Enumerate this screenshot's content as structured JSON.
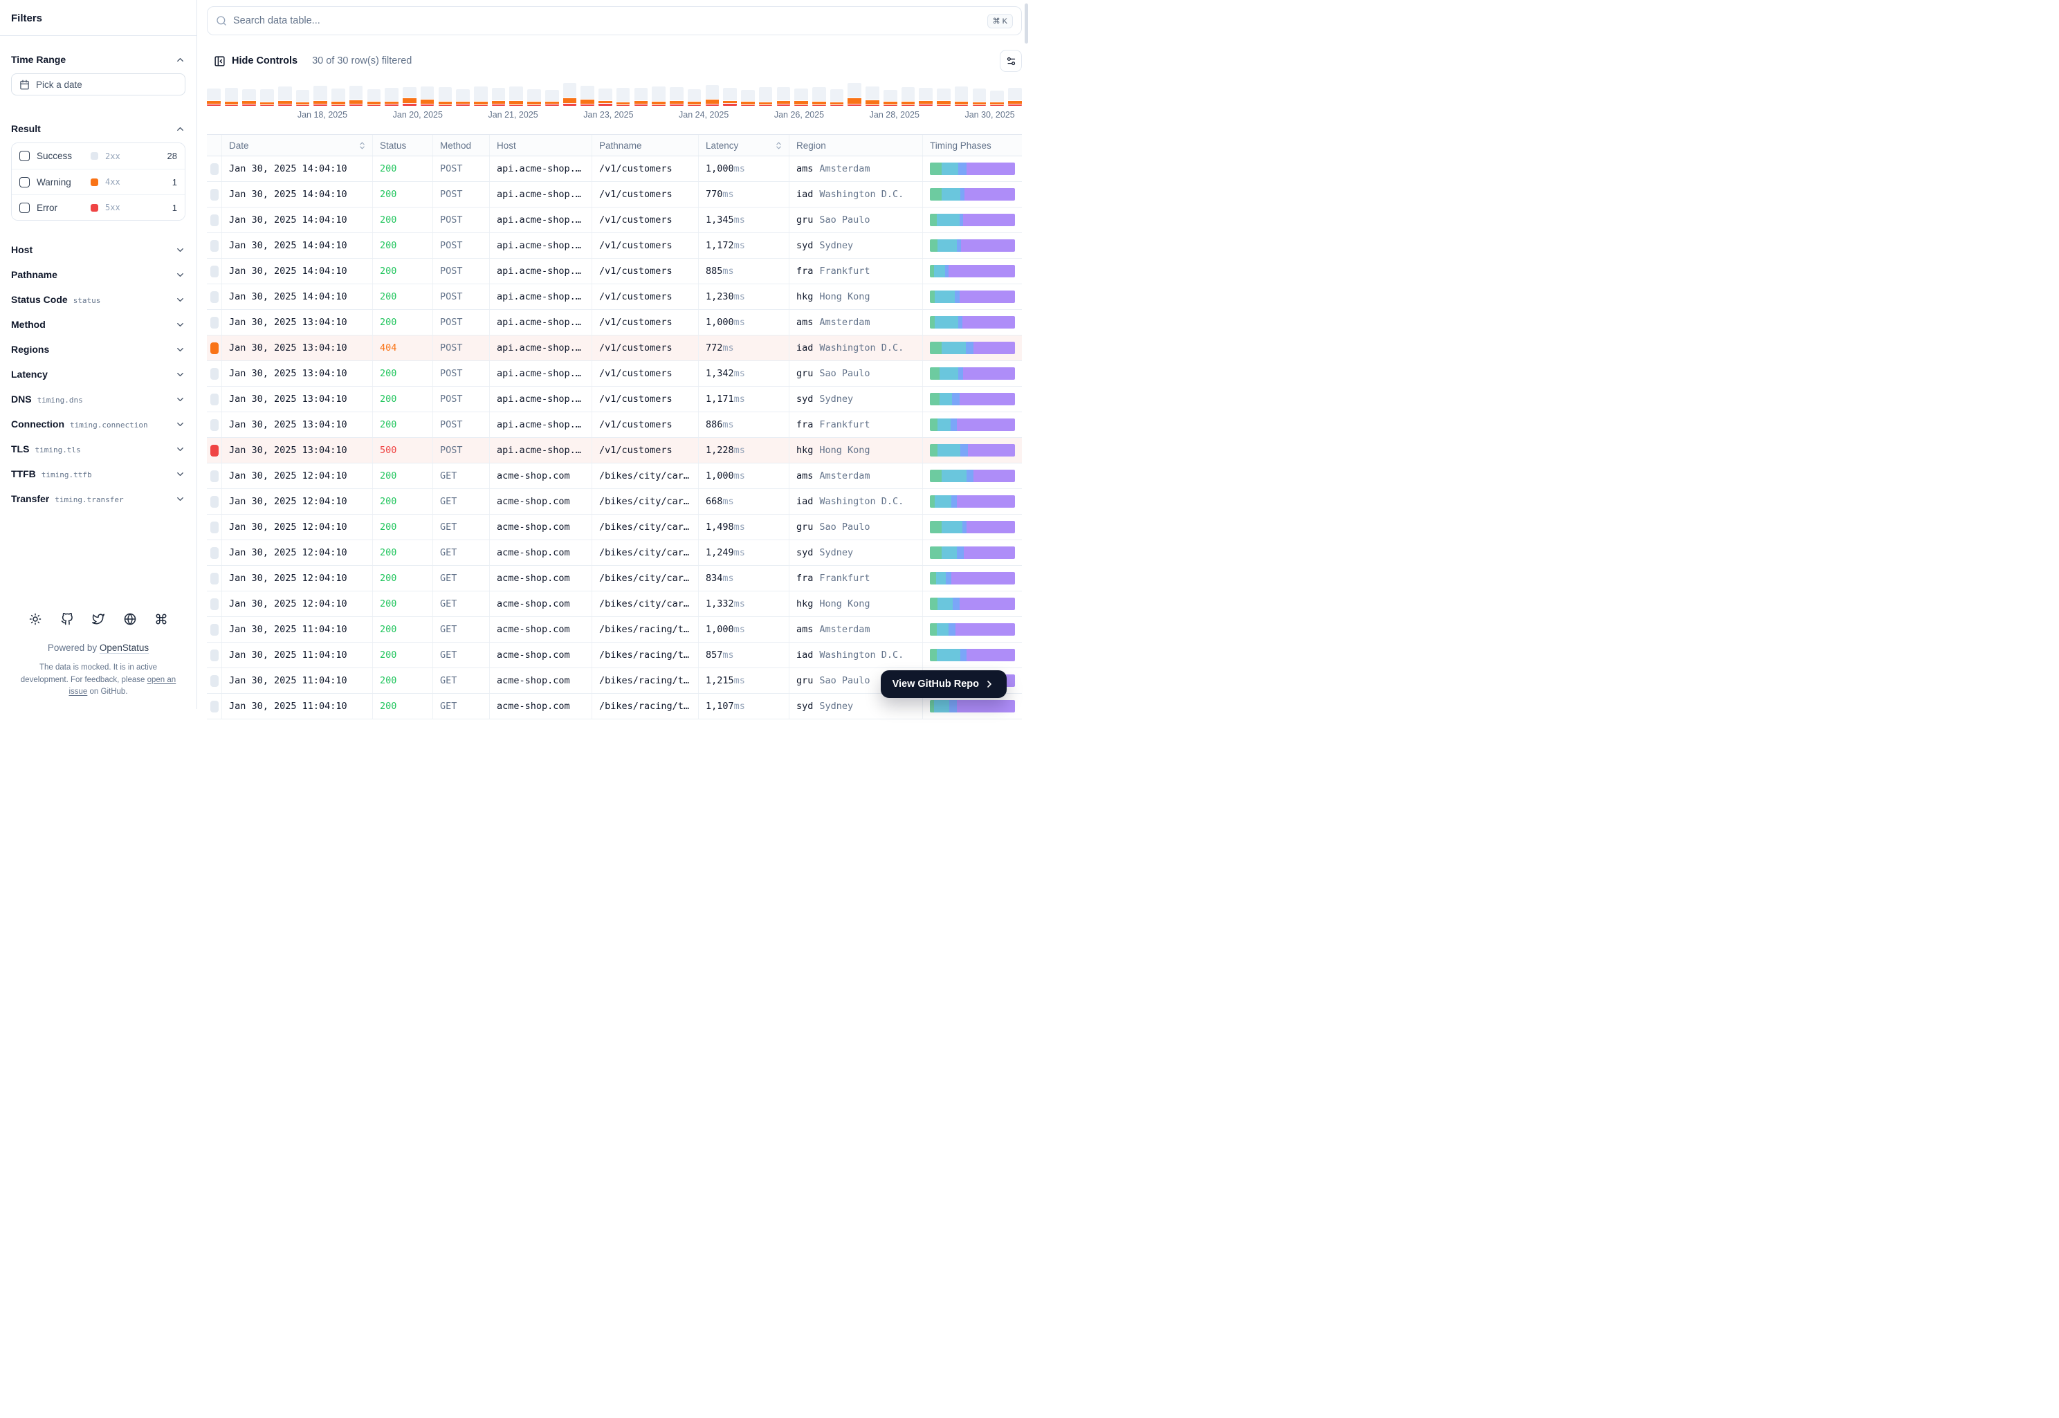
{
  "search": {
    "placeholder": "Search data table...",
    "shortcut": "⌘ K"
  },
  "toolbar": {
    "hide_controls": "Hide Controls",
    "filtered": "30 of 30 row(s) filtered"
  },
  "sidebar": {
    "title": "Filters",
    "time_range": {
      "label": "Time Range",
      "picker": "Pick a date"
    },
    "result": {
      "label": "Result",
      "options": [
        {
          "label": "Success",
          "code": "2xx",
          "count": "28",
          "color": "#e2e8f0"
        },
        {
          "label": "Warning",
          "code": "4xx",
          "count": "1",
          "color": "#f97316"
        },
        {
          "label": "Error",
          "code": "5xx",
          "count": "1",
          "color": "#ef4444"
        }
      ]
    },
    "filters": [
      {
        "label": "Host",
        "code": ""
      },
      {
        "label": "Pathname",
        "code": ""
      },
      {
        "label": "Status Code",
        "code": "status"
      },
      {
        "label": "Method",
        "code": ""
      },
      {
        "label": "Regions",
        "code": ""
      },
      {
        "label": "Latency",
        "code": ""
      },
      {
        "label": "DNS",
        "code": "timing.dns"
      },
      {
        "label": "Connection",
        "code": "timing.connection"
      },
      {
        "label": "TLS",
        "code": "timing.tls"
      },
      {
        "label": "TTFB",
        "code": "timing.ttfb"
      },
      {
        "label": "Transfer",
        "code": "timing.transfer"
      }
    ],
    "footer": {
      "icons": [
        "sun-icon",
        "github-icon",
        "twitter-icon",
        "globe-icon",
        "command-icon"
      ],
      "powered_prefix": "Powered by ",
      "powered_link": "OpenStatus",
      "note_prefix": "The data is mocked. It is in active development. For feedback, please ",
      "note_link": "open an issue",
      "note_suffix": " on GitHub."
    }
  },
  "chart_data": {
    "type": "bar",
    "stacked": true,
    "title": "",
    "xlabel": "",
    "ylabel": "",
    "x_labels": [
      "Jan 18, 2025",
      "Jan 20, 2025",
      "Jan 21, 2025",
      "Jan 23, 2025",
      "Jan 24, 2025",
      "Jan 26, 2025",
      "Jan 28, 2025",
      "Jan 30, 2025"
    ],
    "series_legend": [
      {
        "name": "success",
        "color": "#eef2f7"
      },
      {
        "name": "warning-4xx",
        "color": "#f97316"
      },
      {
        "name": "error-5xx",
        "color": "#ef4444"
      }
    ],
    "unit": "px-height [success, warning, error] per time bucket",
    "bars": [
      [
        17,
        4,
        2
      ],
      [
        19,
        4,
        1
      ],
      [
        16,
        4,
        2
      ],
      [
        18,
        3,
        1
      ],
      [
        20,
        4,
        2
      ],
      [
        17,
        3,
        1
      ],
      [
        21,
        4,
        2
      ],
      [
        18,
        4,
        1
      ],
      [
        20,
        5,
        2
      ],
      [
        17,
        4,
        1
      ],
      [
        19,
        3,
        2
      ],
      [
        15,
        7,
        3
      ],
      [
        18,
        6,
        2
      ],
      [
        20,
        4,
        1
      ],
      [
        17,
        3,
        2
      ],
      [
        21,
        4,
        1
      ],
      [
        18,
        4,
        2
      ],
      [
        20,
        5,
        1
      ],
      [
        17,
        4,
        1
      ],
      [
        16,
        3,
        2
      ],
      [
        21,
        7,
        3
      ],
      [
        19,
        6,
        2
      ],
      [
        17,
        3,
        3
      ],
      [
        20,
        3,
        1
      ],
      [
        18,
        4,
        2
      ],
      [
        21,
        4,
        1
      ],
      [
        19,
        4,
        2
      ],
      [
        17,
        4,
        1
      ],
      [
        20,
        6,
        2
      ],
      [
        18,
        3,
        3
      ],
      [
        16,
        4,
        1
      ],
      [
        21,
        3,
        1
      ],
      [
        19,
        4,
        2
      ],
      [
        17,
        5,
        1
      ],
      [
        20,
        4,
        1
      ],
      [
        18,
        3,
        1
      ],
      [
        21,
        8,
        2
      ],
      [
        19,
        6,
        1
      ],
      [
        16,
        4,
        1
      ],
      [
        20,
        4,
        1
      ],
      [
        18,
        4,
        2
      ],
      [
        17,
        5,
        1
      ],
      [
        21,
        4,
        1
      ],
      [
        19,
        3,
        1
      ],
      [
        16,
        3,
        1
      ],
      [
        18,
        4,
        2
      ]
    ]
  },
  "table": {
    "columns": [
      {
        "label": "Date",
        "sortable": true
      },
      {
        "label": "Status",
        "sortable": false
      },
      {
        "label": "Method",
        "sortable": false
      },
      {
        "label": "Host",
        "sortable": false
      },
      {
        "label": "Pathname",
        "sortable": false
      },
      {
        "label": "Latency",
        "sortable": true
      },
      {
        "label": "Region",
        "sortable": false
      },
      {
        "label": "Timing Phases",
        "sortable": false
      }
    ],
    "latency_unit": "ms",
    "rows": [
      {
        "date": "Jan 30, 2025 14:04:10",
        "status": "200",
        "level": "success",
        "method": "POST",
        "host": "api.acme-shop.…",
        "pathname": "/v1/customers",
        "latency": "1,000",
        "region_code": "ams",
        "region_city": "Amsterdam",
        "timing": [
          14,
          19,
          10,
          57
        ]
      },
      {
        "date": "Jan 30, 2025 14:04:10",
        "status": "200",
        "level": "success",
        "method": "POST",
        "host": "api.acme-shop.…",
        "pathname": "/v1/customers",
        "latency": "770",
        "region_code": "iad",
        "region_city": "Washington D.C.",
        "timing": [
          14,
          22,
          5,
          59
        ]
      },
      {
        "date": "Jan 30, 2025 14:04:10",
        "status": "200",
        "level": "success",
        "method": "POST",
        "host": "api.acme-shop.…",
        "pathname": "/v1/customers",
        "latency": "1,345",
        "region_code": "gru",
        "region_city": "Sao Paulo",
        "timing": [
          8,
          27,
          4,
          61
        ]
      },
      {
        "date": "Jan 30, 2025 14:04:10",
        "status": "200",
        "level": "success",
        "method": "POST",
        "host": "api.acme-shop.…",
        "pathname": "/v1/customers",
        "latency": "1,172",
        "region_code": "syd",
        "region_city": "Sydney",
        "timing": [
          9,
          23,
          5,
          63
        ]
      },
      {
        "date": "Jan 30, 2025 14:04:10",
        "status": "200",
        "level": "success",
        "method": "POST",
        "host": "api.acme-shop.…",
        "pathname": "/v1/customers",
        "latency": "885",
        "region_code": "fra",
        "region_city": "Frankfurt",
        "timing": [
          5,
          13,
          4,
          78
        ]
      },
      {
        "date": "Jan 30, 2025 14:04:10",
        "status": "200",
        "level": "success",
        "method": "POST",
        "host": "api.acme-shop.…",
        "pathname": "/v1/customers",
        "latency": "1,230",
        "region_code": "hkg",
        "region_city": "Hong Kong",
        "timing": [
          6,
          23,
          6,
          65
        ]
      },
      {
        "date": "Jan 30, 2025 13:04:10",
        "status": "200",
        "level": "success",
        "method": "POST",
        "host": "api.acme-shop.…",
        "pathname": "/v1/customers",
        "latency": "1,000",
        "region_code": "ams",
        "region_city": "Amsterdam",
        "timing": [
          6,
          27,
          5,
          62
        ]
      },
      {
        "date": "Jan 30, 2025 13:04:10",
        "status": "404",
        "level": "warning",
        "method": "POST",
        "host": "api.acme-shop.…",
        "pathname": "/v1/customers",
        "latency": "772",
        "region_code": "iad",
        "region_city": "Washington D.C.",
        "timing": [
          14,
          28,
          9,
          49
        ]
      },
      {
        "date": "Jan 30, 2025 13:04:10",
        "status": "200",
        "level": "success",
        "method": "POST",
        "host": "api.acme-shop.…",
        "pathname": "/v1/customers",
        "latency": "1,342",
        "region_code": "gru",
        "region_city": "Sao Paulo",
        "timing": [
          11,
          22,
          6,
          61
        ]
      },
      {
        "date": "Jan 30, 2025 13:04:10",
        "status": "200",
        "level": "success",
        "method": "POST",
        "host": "api.acme-shop.…",
        "pathname": "/v1/customers",
        "latency": "1,171",
        "region_code": "syd",
        "region_city": "Sydney",
        "timing": [
          11,
          15,
          9,
          65
        ]
      },
      {
        "date": "Jan 30, 2025 13:04:10",
        "status": "200",
        "level": "success",
        "method": "POST",
        "host": "api.acme-shop.…",
        "pathname": "/v1/customers",
        "latency": "886",
        "region_code": "fra",
        "region_city": "Frankfurt",
        "timing": [
          9,
          15,
          8,
          68
        ]
      },
      {
        "date": "Jan 30, 2025 13:04:10",
        "status": "500",
        "level": "error",
        "method": "POST",
        "host": "api.acme-shop.…",
        "pathname": "/v1/customers",
        "latency": "1,228",
        "region_code": "hkg",
        "region_city": "Hong Kong",
        "timing": [
          9,
          27,
          9,
          55
        ]
      },
      {
        "date": "Jan 30, 2025 12:04:10",
        "status": "200",
        "level": "success",
        "method": "GET",
        "host": "acme-shop.com",
        "pathname": "/bikes/city/car…",
        "latency": "1,000",
        "region_code": "ams",
        "region_city": "Amsterdam",
        "timing": [
          14,
          29,
          8,
          49
        ]
      },
      {
        "date": "Jan 30, 2025 12:04:10",
        "status": "200",
        "level": "success",
        "method": "GET",
        "host": "acme-shop.com",
        "pathname": "/bikes/city/car…",
        "latency": "668",
        "region_code": "iad",
        "region_city": "Washington D.C.",
        "timing": [
          6,
          19,
          7,
          68
        ]
      },
      {
        "date": "Jan 30, 2025 12:04:10",
        "status": "200",
        "level": "success",
        "method": "GET",
        "host": "acme-shop.com",
        "pathname": "/bikes/city/car…",
        "latency": "1,498",
        "region_code": "gru",
        "region_city": "Sao Paulo",
        "timing": [
          14,
          24,
          5,
          57
        ]
      },
      {
        "date": "Jan 30, 2025 12:04:10",
        "status": "200",
        "level": "success",
        "method": "GET",
        "host": "acme-shop.com",
        "pathname": "/bikes/city/car…",
        "latency": "1,249",
        "region_code": "syd",
        "region_city": "Sydney",
        "timing": [
          14,
          18,
          8,
          60
        ]
      },
      {
        "date": "Jan 30, 2025 12:04:10",
        "status": "200",
        "level": "success",
        "method": "GET",
        "host": "acme-shop.com",
        "pathname": "/bikes/city/car…",
        "latency": "834",
        "region_code": "fra",
        "region_city": "Frankfurt",
        "timing": [
          7,
          12,
          6,
          75
        ]
      },
      {
        "date": "Jan 30, 2025 12:04:10",
        "status": "200",
        "level": "success",
        "method": "GET",
        "host": "acme-shop.com",
        "pathname": "/bikes/city/car…",
        "latency": "1,332",
        "region_code": "hkg",
        "region_city": "Hong Kong",
        "timing": [
          9,
          18,
          8,
          65
        ]
      },
      {
        "date": "Jan 30, 2025 11:04:10",
        "status": "200",
        "level": "success",
        "method": "GET",
        "host": "acme-shop.com",
        "pathname": "/bikes/racing/t…",
        "latency": "1,000",
        "region_code": "ams",
        "region_city": "Amsterdam",
        "timing": [
          8,
          14,
          8,
          70
        ]
      },
      {
        "date": "Jan 30, 2025 11:04:10",
        "status": "200",
        "level": "success",
        "method": "GET",
        "host": "acme-shop.com",
        "pathname": "/bikes/racing/t…",
        "latency": "857",
        "region_code": "iad",
        "region_city": "Washington D.C.",
        "timing": [
          8,
          28,
          7,
          57
        ]
      },
      {
        "date": "Jan 30, 2025 11:04:10",
        "status": "200",
        "level": "success",
        "method": "GET",
        "host": "acme-shop.com",
        "pathname": "/bikes/racing/t…",
        "latency": "1,215",
        "region_code": "gru",
        "region_city": "Sao Paulo",
        "timing": [
          17,
          20,
          3,
          60
        ]
      },
      {
        "date": "Jan 30, 2025 11:04:10",
        "status": "200",
        "level": "success",
        "method": "GET",
        "host": "acme-shop.com",
        "pathname": "/bikes/racing/t…",
        "latency": "1,107",
        "region_code": "syd",
        "region_city": "Sydney",
        "timing": [
          5,
          18,
          9,
          68
        ]
      }
    ]
  },
  "github_button": {
    "label": "View GitHub Repo"
  },
  "colors": {
    "accent_warning": "#f97316",
    "accent_error": "#ef4444",
    "accent_success_text": "#22c55e",
    "level_indicator": {
      "success": "#e4eaf1",
      "warning": "#f97316",
      "error": "#ef4444"
    },
    "timing_phases": [
      "#6dcba0",
      "#6ac6dd",
      "#7ba6f8",
      "#ae8df8"
    ],
    "row_highlight": "#fdf3f1"
  }
}
